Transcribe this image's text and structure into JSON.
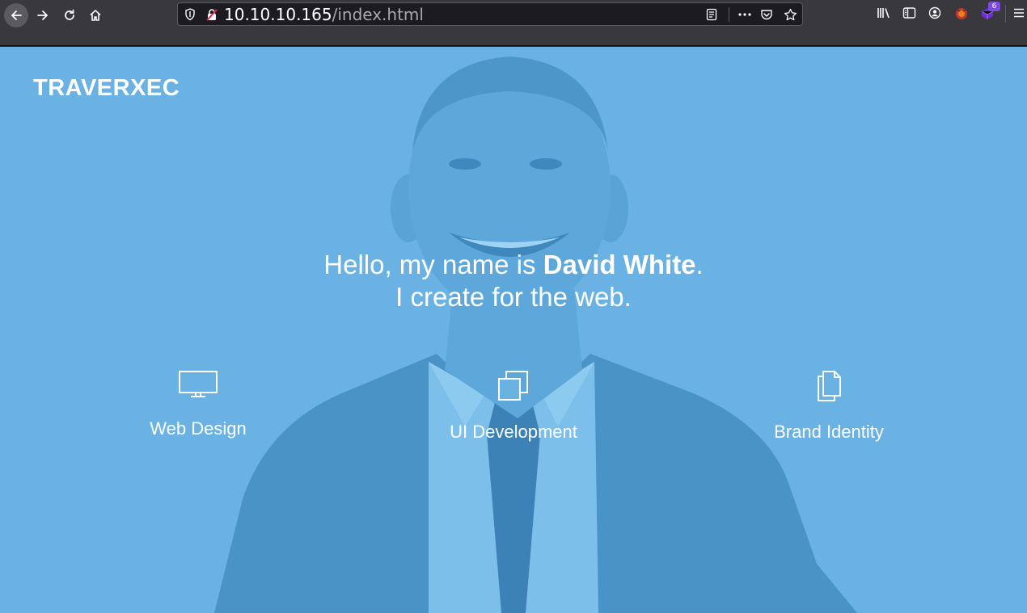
{
  "browser": {
    "url": {
      "host": "10.10.10.165",
      "path": "/index.html"
    },
    "extension_badge": "6",
    "icons": {
      "back": "arrow-left-icon",
      "forward": "arrow-right-icon",
      "reload": "reload-icon",
      "home": "home-icon",
      "tracking_protection": "shield-icon",
      "connection": "insecure-lock-icon",
      "reader_view": "reader-view-icon",
      "page_actions": "more-dots-icon",
      "pocket": "pocket-icon",
      "bookmark": "star-icon",
      "library": "library-icon",
      "sidebar": "sidebar-icon",
      "account": "account-icon",
      "menu": "hamburger-menu-icon"
    }
  },
  "page": {
    "brand": "TRAVERXEC",
    "headline": {
      "prefix": "Hello, my name is ",
      "name": "David White",
      "suffix": ".",
      "line2": "I create for the web."
    },
    "services": [
      {
        "label": "Web Design",
        "icon": "monitor-icon"
      },
      {
        "label": "UI Development",
        "icon": "stacked-squares-icon"
      },
      {
        "label": "Brand Identity",
        "icon": "documents-icon"
      }
    ],
    "overlay_color": "#6ab2e3"
  }
}
